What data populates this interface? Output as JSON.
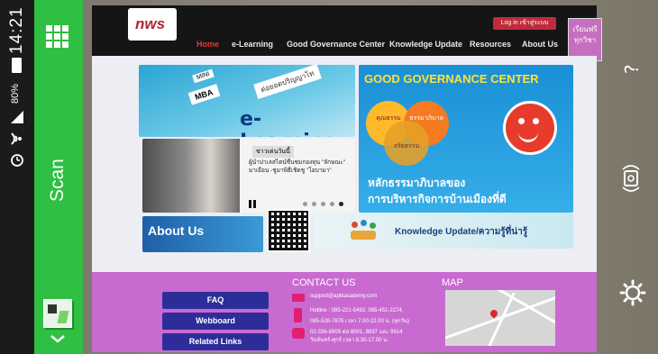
{
  "status": {
    "time": "14:21",
    "battery": "80%"
  },
  "scanner": {
    "scan_label": "Scan"
  },
  "website": {
    "logo": "nws",
    "login": "Log in เข้าสู่ระบบ",
    "nav": [
      "Home",
      "e-Learning",
      "Good Governance Center",
      "Knowledge Update",
      "Resources",
      "About Us"
    ],
    "corner_badge": "เรียนฟรี ทุกวิชา",
    "elearning_title": "e-Learning",
    "elearning_tags": [
      "MINI",
      "MBA",
      "ต่อยอดปริญญาโท"
    ],
    "news_tag": "ข่าวเด่นวันนี้",
    "news_text": "ผู้นำปาเลสไตน์ชื่นชมกองทุน \"ลักษณะ\" มาเยือน -ชูมาพิธีเชิดชู \"โอบามา\"",
    "ggc_title": "GOOD GOVERNANCE CENTER",
    "ggc_circles": [
      "คุณธรรม",
      "ธรรมาภิบาล",
      "จริยธรรม"
    ],
    "ggc_caption_line1": "หลักธรรมาภิบาลของ",
    "ggc_caption_line2": "การบริหารกิจการบ้านเมืองที่ดี",
    "about_title": "About Us",
    "knowledge_label": "Knowledge Update/ความรู้ที่น่ารู้",
    "contact_title": "CONTACT US",
    "contact_email": "support@apbiacademy.com",
    "contact_hotline_1": "Hotline : 085-221-5492, 085-451-2274,",
    "contact_hotline_2": "085-528-7676 เวลา 7.00-22.00 น. (ทุกวัน)",
    "contact_phone_1": "02-336-8909 ต่อ 8001, 8837 และ 9914",
    "contact_phone_2": "วันจันทร์-ศุกร์ เวลา 8.30-17.00 น.",
    "map_title": "MAP",
    "buttons": [
      "FAQ",
      "Webboard",
      "Related Links"
    ]
  },
  "colors": {
    "scan_green": "#2fbf42",
    "nav_red": "#c9312a",
    "contact_purple": "#c96ad0",
    "button_navy": "#2d2d9a"
  }
}
